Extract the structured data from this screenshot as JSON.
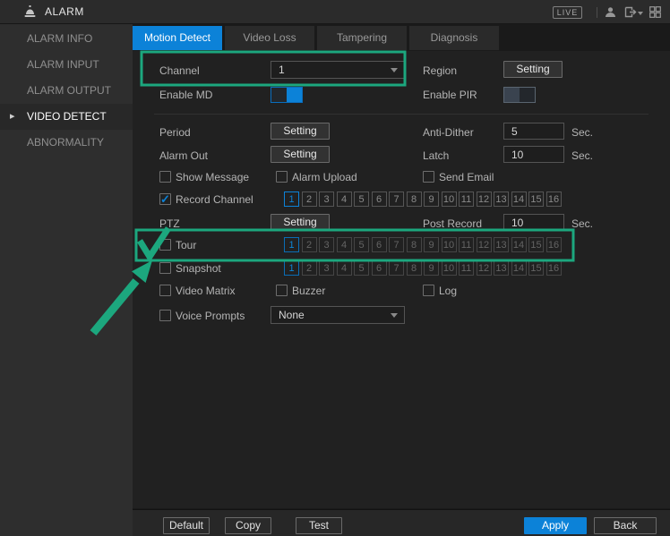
{
  "colors": {
    "accent_blue": "#0C82D8",
    "annotation_green": "#1CA77E"
  },
  "titlebar": {
    "title": "ALARM",
    "live_label": "LIVE"
  },
  "sidebar": {
    "items": [
      {
        "label": "ALARM INFO",
        "active": false
      },
      {
        "label": "ALARM INPUT",
        "active": false
      },
      {
        "label": "ALARM OUTPUT",
        "active": false
      },
      {
        "label": "VIDEO DETECT",
        "active": true
      },
      {
        "label": "ABNORMALITY",
        "active": false
      }
    ]
  },
  "tabs": [
    {
      "label": "Motion Detect",
      "active": true
    },
    {
      "label": "Video Loss",
      "active": false
    },
    {
      "label": "Tampering",
      "active": false
    },
    {
      "label": "Diagnosis",
      "active": false
    }
  ],
  "form": {
    "channel": {
      "label": "Channel",
      "value": "1"
    },
    "region": {
      "label": "Region",
      "button_label": "Setting"
    },
    "enable_md": {
      "label": "Enable MD",
      "on": true
    },
    "enable_pir": {
      "label": "Enable PIR",
      "on": false
    },
    "period": {
      "label": "Period",
      "button_label": "Setting"
    },
    "anti_dither": {
      "label": "Anti-Dither",
      "value": "5",
      "unit": "Sec."
    },
    "alarm_out": {
      "label": "Alarm Out",
      "button_label": "Setting"
    },
    "latch": {
      "label": "Latch",
      "value": "10",
      "unit": "Sec."
    },
    "show_message": {
      "label": "Show Message",
      "checked": false
    },
    "alarm_upload": {
      "label": "Alarm Upload",
      "checked": false
    },
    "send_email": {
      "label": "Send Email",
      "checked": false
    },
    "record_channel": {
      "label": "Record Channel",
      "checked": true,
      "channels": [
        "1",
        "2",
        "3",
        "4",
        "5",
        "6",
        "7",
        "8",
        "9",
        "10",
        "11",
        "12",
        "13",
        "14",
        "15",
        "16"
      ],
      "selected": [
        "1"
      ]
    },
    "ptz": {
      "label": "PTZ",
      "button_label": "Setting"
    },
    "post_record": {
      "label": "Post Record",
      "value": "10",
      "unit": "Sec."
    },
    "tour": {
      "label": "Tour",
      "checked": false,
      "channels": [
        "1",
        "2",
        "3",
        "4",
        "5",
        "6",
        "7",
        "8",
        "9",
        "10",
        "11",
        "12",
        "13",
        "14",
        "15",
        "16"
      ],
      "selected": [
        "1"
      ]
    },
    "snapshot": {
      "label": "Snapshot",
      "checked": false,
      "channels": [
        "1",
        "2",
        "3",
        "4",
        "5",
        "6",
        "7",
        "8",
        "9",
        "10",
        "11",
        "12",
        "13",
        "14",
        "15",
        "16"
      ],
      "selected": [
        "1"
      ]
    },
    "video_matrix": {
      "label": "Video Matrix",
      "checked": false
    },
    "buzzer": {
      "label": "Buzzer",
      "checked": false
    },
    "log": {
      "label": "Log",
      "checked": false
    },
    "voice_prompts": {
      "label": "Voice Prompts",
      "checked": false,
      "value": "None"
    }
  },
  "footer": {
    "default_label": "Default",
    "copy_label": "Copy",
    "test_label": "Test",
    "apply_label": "Apply",
    "back_label": "Back"
  }
}
